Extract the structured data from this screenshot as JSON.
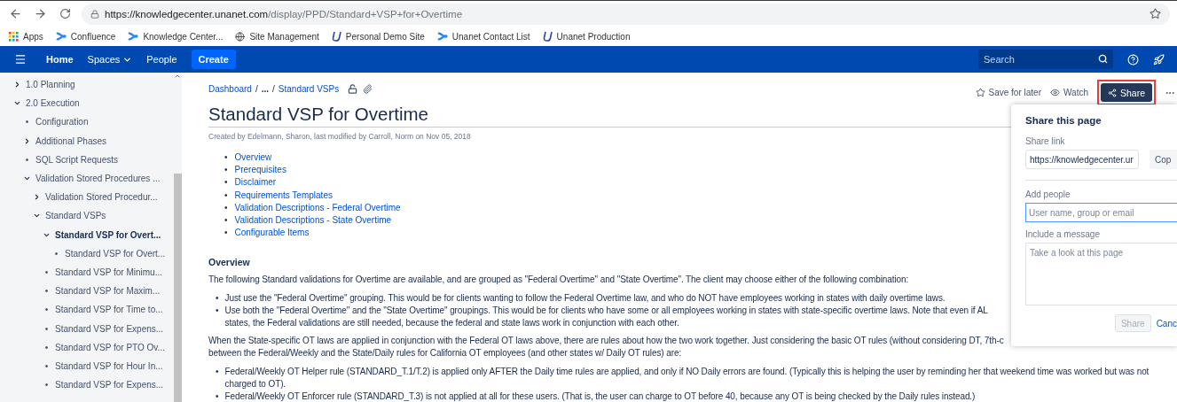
{
  "browser": {
    "url_host": "https://knowledgecenter.unanet.com",
    "url_path": "/display/PPD/Standard+VSP+for+Overtime",
    "bookmarks": [
      {
        "kind": "apps",
        "label": "Apps"
      },
      {
        "kind": "confluence",
        "label": "Confluence"
      },
      {
        "kind": "confluence",
        "label": "Knowledge Center..."
      },
      {
        "kind": "globe",
        "label": "Site Management"
      },
      {
        "kind": "unanet",
        "label": "Personal Demo Site"
      },
      {
        "kind": "confluence",
        "label": "Unanet Contact List"
      },
      {
        "kind": "unanet",
        "label": "Unanet Production"
      }
    ]
  },
  "navbar": {
    "items": [
      {
        "label": "Home",
        "selected": true,
        "dropdown": false
      },
      {
        "label": "Spaces",
        "selected": false,
        "dropdown": true
      },
      {
        "label": "People",
        "selected": false,
        "dropdown": false
      }
    ],
    "create": "Create",
    "search_placeholder": "Search"
  },
  "sidebar": {
    "items": [
      {
        "kind": "folder",
        "label": "1.0 Planning",
        "expanded": false,
        "selected": false
      },
      {
        "kind": "folder",
        "label": "2.0 Execution",
        "expanded": true,
        "selected": false,
        "children": [
          {
            "kind": "page",
            "marker": "•",
            "label": "Configuration",
            "selected": false
          },
          {
            "kind": "folder",
            "label": "Additional Phases",
            "expanded": false,
            "selected": false
          },
          {
            "kind": "page",
            "marker": "•",
            "label": "SQL Script Requests",
            "selected": false
          },
          {
            "kind": "folder",
            "label": "Validation Stored Procedures ...",
            "expanded": true,
            "selected": false,
            "children": [
              {
                "kind": "folder",
                "label": "Validation Stored Procedur...",
                "expanded": false,
                "selected": false
              },
              {
                "kind": "folder",
                "label": "Standard VSPs",
                "expanded": true,
                "selected": false,
                "children": [
                  {
                    "kind": "folder",
                    "label": "Standard VSP for Overt...",
                    "expanded": true,
                    "selected": true,
                    "children": [
                      {
                        "kind": "page",
                        "marker": "•",
                        "label": "Standard VSP for Overt...",
                        "selected": false
                      }
                    ]
                  },
                  {
                    "kind": "page",
                    "marker": "•",
                    "label": "Standard VSP for Minimu...",
                    "selected": false
                  },
                  {
                    "kind": "page",
                    "marker": "•",
                    "label": "Standard VSP for Maxim...",
                    "selected": false
                  },
                  {
                    "kind": "page",
                    "marker": "•",
                    "label": "Standard VSP for Time to...",
                    "selected": false
                  },
                  {
                    "kind": "page",
                    "marker": "•",
                    "label": "Standard VSP for Expens...",
                    "selected": false
                  },
                  {
                    "kind": "page",
                    "marker": "•",
                    "label": "Standard VSP for PTO Ov...",
                    "selected": false
                  },
                  {
                    "kind": "page",
                    "marker": "•",
                    "label": "Standard VSP for Hour In...",
                    "selected": false
                  },
                  {
                    "kind": "page",
                    "marker": "•",
                    "label": "Standard VSP for Expens...",
                    "selected": false
                  }
                ]
              }
            ]
          }
        ]
      }
    ]
  },
  "page": {
    "breadcrumbs": [
      {
        "kind": "link",
        "text": "Dashboard"
      },
      {
        "kind": "separator",
        "text": "/"
      },
      {
        "kind": "ellipsis",
        "text": "..."
      },
      {
        "kind": "separator",
        "text": "/"
      },
      {
        "kind": "link",
        "text": "Standard VSPs"
      }
    ],
    "actions": {
      "save": "Save for later",
      "watch": "Watch",
      "share": "Share",
      "share_highlighted": true
    },
    "title": "Standard VSP for Overtime",
    "meta": "Created by Edelmann, Sharon, last modified by Carroll, Norm on Nov 05, 2018",
    "toc": [
      {
        "marker": "•",
        "label": "Overview"
      },
      {
        "marker": "•",
        "label": "Prerequisites"
      },
      {
        "marker": "•",
        "label": "Disclaimer"
      },
      {
        "marker": "•",
        "label": "Requirements Templates"
      },
      {
        "marker": "•",
        "label": "Validation Descriptions - Federal Overtime"
      },
      {
        "marker": "•",
        "label": "Validation Descriptions - State Overtime"
      },
      {
        "marker": "•",
        "label": "Configurable Items"
      }
    ],
    "heading": "Overview",
    "blocks": [
      {
        "kind": "paragraph",
        "lines": [
          "The following Standard validations for Overtime are available, and are grouped as \"Federal Overtime\" and \"State Overtime\".  The client may choose either of the following combination:"
        ]
      },
      {
        "kind": "list",
        "items": [
          {
            "marker": "•",
            "lines": [
              "Just use the \"Federal Overtime\" grouping.  This would be for clients wanting to follow the Federal Overtime law, and who do NOT have employees working in states with daily overtime laws."
            ]
          },
          {
            "marker": "•",
            "lines": [
              "Use both the \"Federal Overtime\" and the \"State Overtime\" groupings.  This would be for clients who have some or all employees working in states with state-specific overtime laws.  Note that even if AL",
              "states, the Federal validations are still needed, because the federal and state laws work in conjunction with each other."
            ]
          }
        ]
      },
      {
        "kind": "paragraph",
        "lines": [
          "When the State-specific OT laws are applied in conjunction with the Federal OT laws above, there are rules about how the two work together.  Just considering the basic OT rules (without considering DT, 7th-c",
          "between the Federal/Weekly and the State/Daily rules for California OT employees (and other states w/ Daily OT rules)  are:"
        ]
      },
      {
        "kind": "list",
        "items": [
          {
            "marker": "•",
            "lines": [
              "Federal/Weekly OT Helper rule (STANDARD_T.1/T.2) is applied only AFTER the Daily time rules are applied, and only if NO Daily errors are found. (Typically this is helping the user by reminding her that weekend time was worked but was not",
              "charged to OT)."
            ]
          },
          {
            "marker": "•",
            "lines": [
              "Federal/Weekly OT Enforcer rule (STANDARD_T.3) is not applied at all for these users.  (That is, the user can charge to OT before 40, because any OT is being checked by the Daily rules instead.)"
            ]
          }
        ]
      }
    ]
  },
  "share_dialog": {
    "title": "Share this page",
    "link_label": "Share link",
    "link_value": "https://knowledgecenter.ur",
    "copy": "Cop",
    "people_label": "Add people",
    "people_placeholder": "User name, group or email",
    "people_focused": true,
    "message_label": "Include a message",
    "message_placeholder": "Take a look at this page",
    "share": "Share",
    "share_disabled": true,
    "cancel": "Canc"
  }
}
